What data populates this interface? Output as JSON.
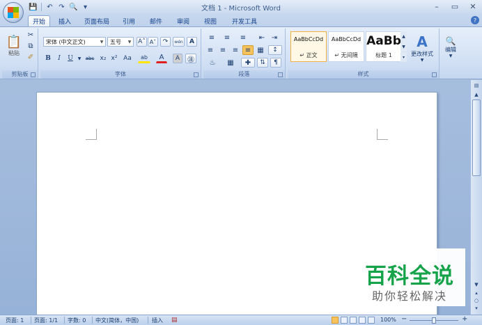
{
  "window": {
    "title": "文档 1 - Microsoft Word",
    "controls": [
      "–",
      "▭",
      "✕"
    ]
  },
  "quick_access": {
    "icons": [
      "save-icon",
      "undo-icon",
      "redo-icon",
      "print-preview-icon",
      "customize-icon"
    ]
  },
  "tabs": [
    {
      "label": "开始",
      "active": true
    },
    {
      "label": "插入"
    },
    {
      "label": "页面布局"
    },
    {
      "label": "引用"
    },
    {
      "label": "邮件"
    },
    {
      "label": "审阅"
    },
    {
      "label": "视图"
    },
    {
      "label": "开发工具"
    }
  ],
  "help_glyph": "?",
  "ribbon": {
    "clipboard": {
      "label": "剪贴板",
      "paste": "粘贴"
    },
    "font": {
      "label": "字体",
      "font_name": "宋体 (中文正文)",
      "font_size": "五号",
      "grow": "A˄",
      "shrink": "A˅",
      "phonetic": "wén",
      "bold": "B",
      "italic": "I",
      "underline": "U",
      "strike": "abc",
      "subscript": "x₂",
      "superscript": "x²",
      "change_case": "Aa",
      "highlight": "ab",
      "font_color": "A",
      "char_shade": "A"
    },
    "paragraph": {
      "label": "段落"
    },
    "styles": {
      "label": "样式",
      "items": [
        {
          "sample": "AaBbCcDd",
          "name": "↵ 正文",
          "selected": true
        },
        {
          "sample": "AaBbCcDd",
          "name": "↵ 无间隔"
        },
        {
          "sample": "AaBb",
          "name": "标题 1"
        }
      ],
      "change_styles": "更改样式"
    },
    "editing": {
      "label": "编辑"
    }
  },
  "watermark": {
    "title": "百科全说",
    "subtitle": "助你轻松解决"
  },
  "status": {
    "page": "页面: 1",
    "pages": "页面: 1/1",
    "words": "字数: 0",
    "language": "中文(简体，中国)",
    "insert": "插入",
    "zoom": "100%",
    "zoom_out": "−",
    "zoom_in": "+"
  }
}
